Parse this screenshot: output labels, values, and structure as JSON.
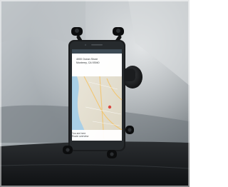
{
  "screen": {
    "address_lines": [
      "4000 Ocean Shore",
      "Monterey, CA 93940",
      ""
    ],
    "status_lines": [
      "You are here",
      "Route overview"
    ]
  },
  "colors": {
    "map_land": "#e9e5d9",
    "map_water": "#a9cfe6",
    "dash": "#1c1f22"
  }
}
